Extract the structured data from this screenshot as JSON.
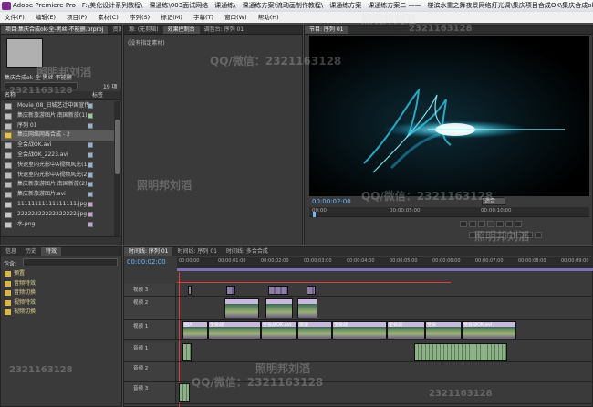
{
  "window": {
    "title": "Adobe Premiere Pro - F:\\美化设计系列教程\\一课通练\\003面试网络一课通练\\一课通练方案\\流动画制作教程\\一课通练方案一课通练方案二 ——一楼滨水重之舞夜景网络灯光调\\集庆项目合成OK\\集庆合成ok-全-黑丝-不能删.prproj"
  },
  "menu": [
    "文件(F)",
    "编辑(E)",
    "项目(P)",
    "素材(C)",
    "序列(S)",
    "标记(M)",
    "字幕(T)",
    "窗口(W)",
    "帮助(H)"
  ],
  "project_panel": {
    "tabs": [
      "项目:集庆合成ok-全-黑丝-不能删.prproj",
      "资源管理器"
    ],
    "name": "集庆合成ok-全-黑丝-不能删",
    "count": "19 项",
    "col_name": "名称",
    "col_label": "标签",
    "items": [
      "Movie_08_旧城艺迁中国宣传",
      "集庆新旅游图片 南国新旅(1)",
      "序列 01",
      "集庆网络网线合成 - 2",
      "全会战OK.avi",
      "全会战OK_2223.avi",
      "快速室内光影中A视频风光(1)",
      "快速室内光影中A视频风光(2)",
      "集庆新旅游图片 南国新旅(2)",
      "集庆新旅游图片.avi",
      "11111111111111111.jpg",
      "22222222222222222.jpg",
      "水.png"
    ]
  },
  "source_panel": {
    "tabs": [
      "源: (无剪辑)",
      "效果控制台",
      "调音台: 序列 01"
    ],
    "empty_text": "(没有指定素材)"
  },
  "program_monitor": {
    "tab": "节目: 序列 01",
    "timecode": "00:00:02:00",
    "fit": "适合",
    "ruler": [
      "00:00",
      "00:00:05:00",
      "00:00:10:00"
    ]
  },
  "effects_panel": {
    "tabs": [
      "信息",
      "历史",
      "特效"
    ],
    "search_label": "包含:",
    "folders": [
      "预置",
      "音频特效",
      "音频切换",
      "视频特效",
      "视频切换"
    ]
  },
  "timeline": {
    "tabs": [
      "时间线: 序列 01",
      "时间线: 序列 01",
      "时间线: 多合合成"
    ],
    "timecode": "00:00:02:00",
    "ruler": [
      "00:00:00",
      "00:00:01:00",
      "00:00:02:00",
      "00:00:03:00",
      "00:00:04:00",
      "00:00:05:00",
      "00:00:06:00",
      "00:00:07:00",
      "00:00:08:00",
      "00:00:09:00"
    ],
    "tracks": [
      "视频 3",
      "视频 2",
      "视频 1",
      "音频 1",
      "音频 2",
      "音频 3"
    ],
    "clip_labels": [
      "图片",
      "全会战",
      "全会战OK.avi",
      "快速",
      "全会战",
      "全会战",
      "全会",
      "全会战OK.avi"
    ]
  },
  "watermarks": [
    "QQ/微信：2321163128",
    "照明邦刘滔",
    "2321163128",
    "照明邦刘滔",
    "2321163128",
    "照明邦刘滔",
    "QQ/微信：2321163128",
    "照明邦刘滔",
    "2321163128",
    "QQ/微信：2321163128",
    "照明邦刘滔",
    "2321163128"
  ]
}
